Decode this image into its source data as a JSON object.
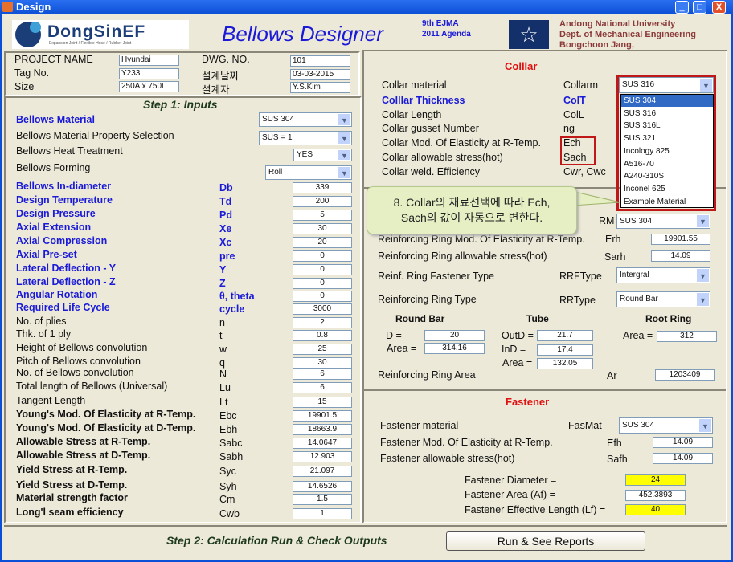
{
  "window": {
    "title": "Design",
    "minimize": "_",
    "maximize": "□",
    "close": "X"
  },
  "header": {
    "logo_text": "DongSinEF",
    "logo_tagline": "Expansion Joint / Flexible Hose / Rubber Joint",
    "app_title": "Bellows  Designer",
    "ejma_line1": "9th EJMA",
    "ejma_line2": "2011 Agenda",
    "univ_line1": "Andong National University",
    "univ_line2": "Dept. of Mechanical Engineering",
    "univ_line3": "Bongchoon Jang,"
  },
  "project": {
    "name_label": "PROJECT NAME",
    "name_value": "Hyundai",
    "tag_label": "Tag No.",
    "tag_value": "Y233",
    "size_label": "Size",
    "size_value": "250A x 750L",
    "dwg_label": "DWG. NO.",
    "dwg_value": "101",
    "date_label": "설계날짜",
    "date_value": "03-03-2015",
    "designer_label": "설계자",
    "designer_value": "Y.S.Kim"
  },
  "step1": {
    "title": "Step 1: Inputs",
    "selects": [
      {
        "label": "Bellows  Material",
        "value": "SUS 304"
      },
      {
        "label": "Bellows  Material Property Selection",
        "value": "SUS = 1"
      },
      {
        "label": "Bellows  Heat Treatment",
        "value": "YES"
      },
      {
        "label": "Bellows  Forming",
        "value": "Roll"
      }
    ],
    "rows": [
      {
        "label": "Bellows  In-diameter",
        "symbol": "Db",
        "value": "339"
      },
      {
        "label": "Design Temperature",
        "symbol": "Td",
        "value": "200"
      },
      {
        "label": "Design Pressure",
        "symbol": "Pd",
        "value": "5"
      },
      {
        "label": "Axial Extension",
        "symbol": "Xe",
        "value": "30"
      },
      {
        "label": "Axial Compression",
        "symbol": "Xc",
        "value": "20"
      },
      {
        "label": "Axial Pre-set",
        "symbol": "pre",
        "value": "0"
      },
      {
        "label": "Lateral Deflection - Y",
        "symbol": "Y",
        "value": "0"
      },
      {
        "label": "Lateral Deflection - Z",
        "symbol": "Z",
        "value": "0"
      },
      {
        "label": "Angular Rotation",
        "symbol": "θ, theta",
        "value": "0"
      },
      {
        "label": "Required Life Cycle",
        "symbol": "cycle",
        "value": "3000"
      },
      {
        "label": "No. of plies",
        "symbol": "n",
        "value": "2"
      },
      {
        "label": "Thk. of 1 ply",
        "symbol": "t",
        "value": "0.8"
      },
      {
        "label": "Height of Bellows convolution",
        "symbol": "w",
        "value": "25"
      },
      {
        "label": "Pitch of Bellows convolution",
        "symbol": "q",
        "value": "30"
      },
      {
        "label": "No. of Bellows convolution",
        "symbol": "N",
        "value": "6"
      },
      {
        "label": "Total length of Bellows (Universal)",
        "symbol": "Lu",
        "value": "6"
      },
      {
        "label": "Tangent Length",
        "symbol": "Lt",
        "value": "15"
      },
      {
        "label": "Young's Mod. Of Elasticity at R-Temp.",
        "symbol": "Ebc",
        "value": "19901.5"
      },
      {
        "label": "Young's Mod. Of Elasticity at D-Temp.",
        "symbol": "Ebh",
        "value": "18663.9"
      },
      {
        "label": "Allowable Stress at R-Temp.",
        "symbol": "Sabc",
        "value": "14.0647"
      },
      {
        "label": "Allowable Stress at D-Temp.",
        "symbol": "Sabh",
        "value": "12.903"
      },
      {
        "label": "Yield Stress at R-Temp.",
        "symbol": "Syc",
        "value": "21.097"
      },
      {
        "label": "Yield Stress at D-Temp.",
        "symbol": "Syh",
        "value": "14.6526"
      },
      {
        "label": "Material strength factor",
        "symbol": "Cm",
        "value": "1.5"
      },
      {
        "label": "Long'l seam efficiency",
        "symbol": "Cwb",
        "value": "1"
      }
    ]
  },
  "collar": {
    "title": "Colllar",
    "rows": [
      {
        "label": "Collar  material",
        "symbol": "Collarm"
      },
      {
        "label": "Colllar Thickness",
        "symbol": "ColT"
      },
      {
        "label": "Collar Length",
        "symbol": "ColL"
      },
      {
        "label": "Collar gusset Number",
        "symbol": "ng"
      },
      {
        "label": "Collar Mod. Of Elasticity at R-Temp.",
        "symbol": "Ech"
      },
      {
        "label": "Collar allowable stress(hot)",
        "symbol": "Sach"
      },
      {
        "label": "Collar weld. Efficiency",
        "symbol": "Cwr, Cwc"
      }
    ],
    "material_value": "SUS 316",
    "options": [
      "SUS 304",
      "SUS 316",
      "SUS 316L",
      "SUS 321",
      "Incology 825",
      "A516-70",
      "A240-310S",
      "Inconel 625",
      "Example Material"
    ]
  },
  "callout": {
    "line1": "8. Collar의 재료선택에 따라 Ech,",
    "line2": "Sach의 값이 자동으로 변한다."
  },
  "ring": {
    "material_symbol": "RM",
    "material_value": "SUS 304",
    "erh_label": "Reinforcing Ring Mod. Of Elasticity at R-Temp.",
    "erh_symbol": "Erh",
    "erh_value": "19901.55",
    "sarh_label": "Reinforcing Ring allowable stress(hot)",
    "sarh_symbol": "Sarh",
    "sarh_value": "14.09",
    "fastener_type_label": "Reinf. Ring Fastener  Type",
    "fastener_type_symbol": "RRFType",
    "fastener_type_value": "Intergral",
    "type_label": "Reinforcing Ring  Type",
    "type_symbol": "RRType",
    "type_value": "Round Bar",
    "round_bar": {
      "title": "Round Bar",
      "d_label": "D =",
      "d_value": "20",
      "area_label": "Area =",
      "area_value": "314.16"
    },
    "tube": {
      "title": "Tube",
      "outd_label": "OutD =",
      "outd_value": "21.7",
      "ind_label": "InD =",
      "ind_value": "17.4",
      "area_label": "Area =",
      "area_value": "132.05"
    },
    "root_ring": {
      "title": "Root Ring",
      "area_label": "Area =",
      "area_value": "312"
    },
    "area_label": "Reinforcing Ring Area",
    "area_symbol": "Ar",
    "area_value": "1203409"
  },
  "fastener": {
    "title": "Fastener",
    "material_label": "Fastener  material",
    "material_symbol": "FasMat",
    "material_value": "SUS 304",
    "efh_label": "Fastener Mod. Of Elasticity at R-Temp.",
    "efh_symbol": "Efh",
    "efh_value": "14.09",
    "safh_label": "Fastener allowable stress(hot)",
    "safh_symbol": "Safh",
    "safh_value": "14.09",
    "diameter_label": "Fastener Diameter =",
    "diameter_value": "24",
    "af_label": "Fastener Area (Af) =",
    "af_value": "452.3893",
    "lf_label": "Fastener Effective Length (Lf) =",
    "lf_value": "40"
  },
  "step2": {
    "title": "Step 2: Calculation Run & Check Outputs",
    "run_button": "Run & See Reports"
  },
  "colors": {
    "title_bar": "#0b4fd6",
    "panel_bg": "#ece9d8",
    "label_blue": "#1a1ad8",
    "section_red": "#e01010",
    "highlight_yellow": "#ffff00",
    "callout_green": "#e6efc4"
  }
}
